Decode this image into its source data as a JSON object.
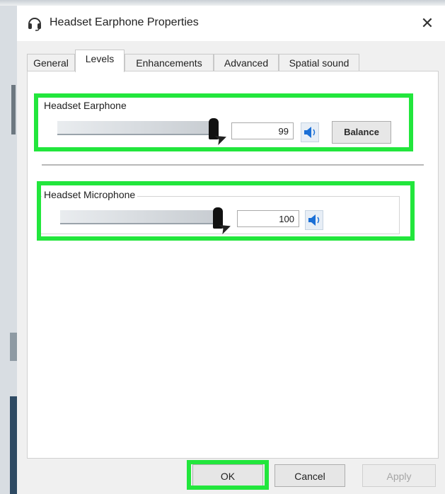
{
  "window": {
    "title": "Headset Earphone Properties",
    "close_glyph": "✕"
  },
  "tabs": [
    {
      "label": "General"
    },
    {
      "label": "Levels",
      "active": true
    },
    {
      "label": "Enhancements"
    },
    {
      "label": "Advanced"
    },
    {
      "label": "Spatial sound"
    }
  ],
  "levels": {
    "earphone": {
      "label": "Headset Earphone",
      "value": "99",
      "level": 0.99,
      "balance_label": "Balance"
    },
    "microphone": {
      "label": "Headset Microphone",
      "value": "100",
      "level": 1.0
    }
  },
  "buttons": {
    "ok": "OK",
    "cancel": "Cancel",
    "apply": "Apply"
  },
  "colors": {
    "highlight": "#22e63c",
    "speaker_icon": "#1a6fd6"
  }
}
